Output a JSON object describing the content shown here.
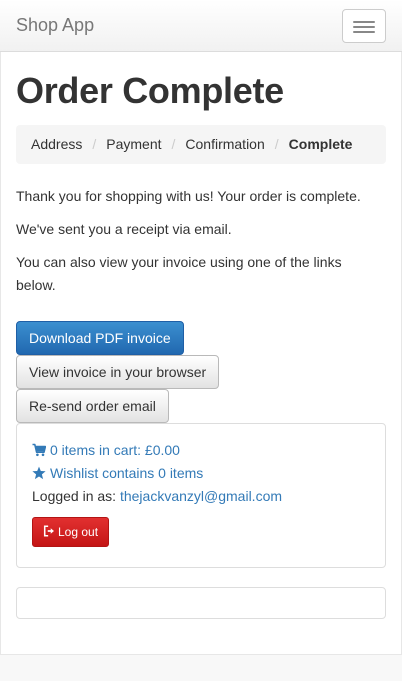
{
  "navbar": {
    "brand": "Shop App",
    "menu_icon": "hamburger-menu-icon"
  },
  "page": {
    "title": "Order Complete"
  },
  "breadcrumb": {
    "items": [
      "Address",
      "Payment",
      "Confirmation",
      "Complete"
    ],
    "separator": "/"
  },
  "messages": {
    "thanks": "Thank you for shopping with us! Your order is complete.",
    "receipt": "We've sent you a receipt via email.",
    "invoice_hint": "You can also view your invoice using one of the links below."
  },
  "actions": {
    "download_pdf": "Download PDF invoice",
    "view_browser": "View invoice in your browser",
    "resend_email": "Re-send order email"
  },
  "account_panel": {
    "cart_text": "0 items in cart: £0.00",
    "cart_icon": "shopping-cart-icon",
    "wishlist_text": "Wishlist contains 0 items",
    "wishlist_icon": "star-icon",
    "logged_in_label": "Logged in as:",
    "email": "thejackvanzyl@gmail.com",
    "logout_label": "Log out",
    "logout_icon": "logout-icon"
  },
  "colors": {
    "link": "#337ab7",
    "primary": "#2168b0",
    "danger": "#c41515"
  }
}
